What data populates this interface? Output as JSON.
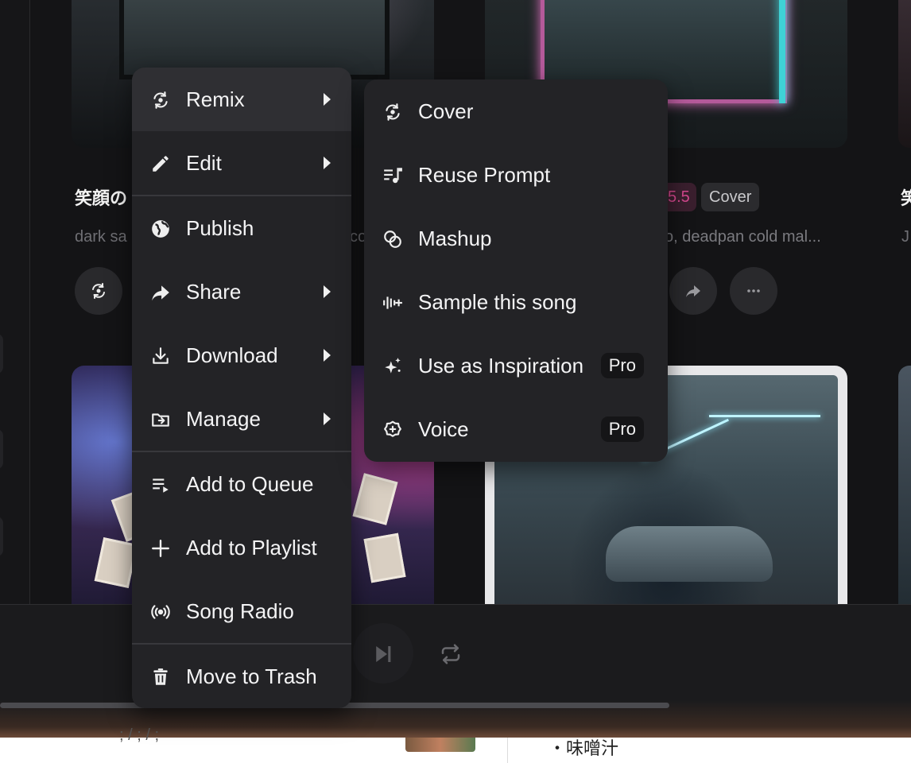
{
  "background": {
    "song_title": "笑顔の",
    "song_title_right": "笑",
    "desc_left": "dark sa",
    "desc_left_cut": "co",
    "desc_mid": "o, deadpan cold mal...",
    "desc_right": "J",
    "version_badge": "5.5",
    "cover_badge": "Cover",
    "lower_text": "・味噌汁",
    "lower_text_left": "; / ;  / ;"
  },
  "menu": {
    "items": [
      {
        "label": "Remix",
        "icon": "remix-icon",
        "submenu": true
      },
      {
        "label": "Edit",
        "icon": "pencil-icon",
        "submenu": true
      },
      {
        "label": "Publish",
        "icon": "globe-icon",
        "submenu": false
      },
      {
        "label": "Share",
        "icon": "share-arrow-icon",
        "submenu": true
      },
      {
        "label": "Download",
        "icon": "download-icon",
        "submenu": true
      },
      {
        "label": "Manage",
        "icon": "folder-icon",
        "submenu": true
      },
      {
        "label": "Add to Queue",
        "icon": "queue-icon",
        "submenu": false
      },
      {
        "label": "Add to Playlist",
        "icon": "plus-icon",
        "submenu": false
      },
      {
        "label": "Song Radio",
        "icon": "radio-icon",
        "submenu": false
      },
      {
        "label": "Move to Trash",
        "icon": "trash-icon",
        "submenu": false
      }
    ],
    "active_item": "Remix"
  },
  "submenu": {
    "items": [
      {
        "label": "Cover",
        "icon": "cover-icon"
      },
      {
        "label": "Reuse Prompt",
        "icon": "prompt-music-icon"
      },
      {
        "label": "Mashup",
        "icon": "mashup-icon"
      },
      {
        "label": "Sample this song",
        "icon": "waveform-plus-icon"
      },
      {
        "label": "Use as Inspiration",
        "icon": "sparkle-icon",
        "badge": "Pro"
      },
      {
        "label": "Voice",
        "icon": "voice-icon",
        "badge": "Pro"
      }
    ]
  },
  "colors": {
    "menu_bg": "#232326",
    "accent_pink": "#d6488f"
  }
}
